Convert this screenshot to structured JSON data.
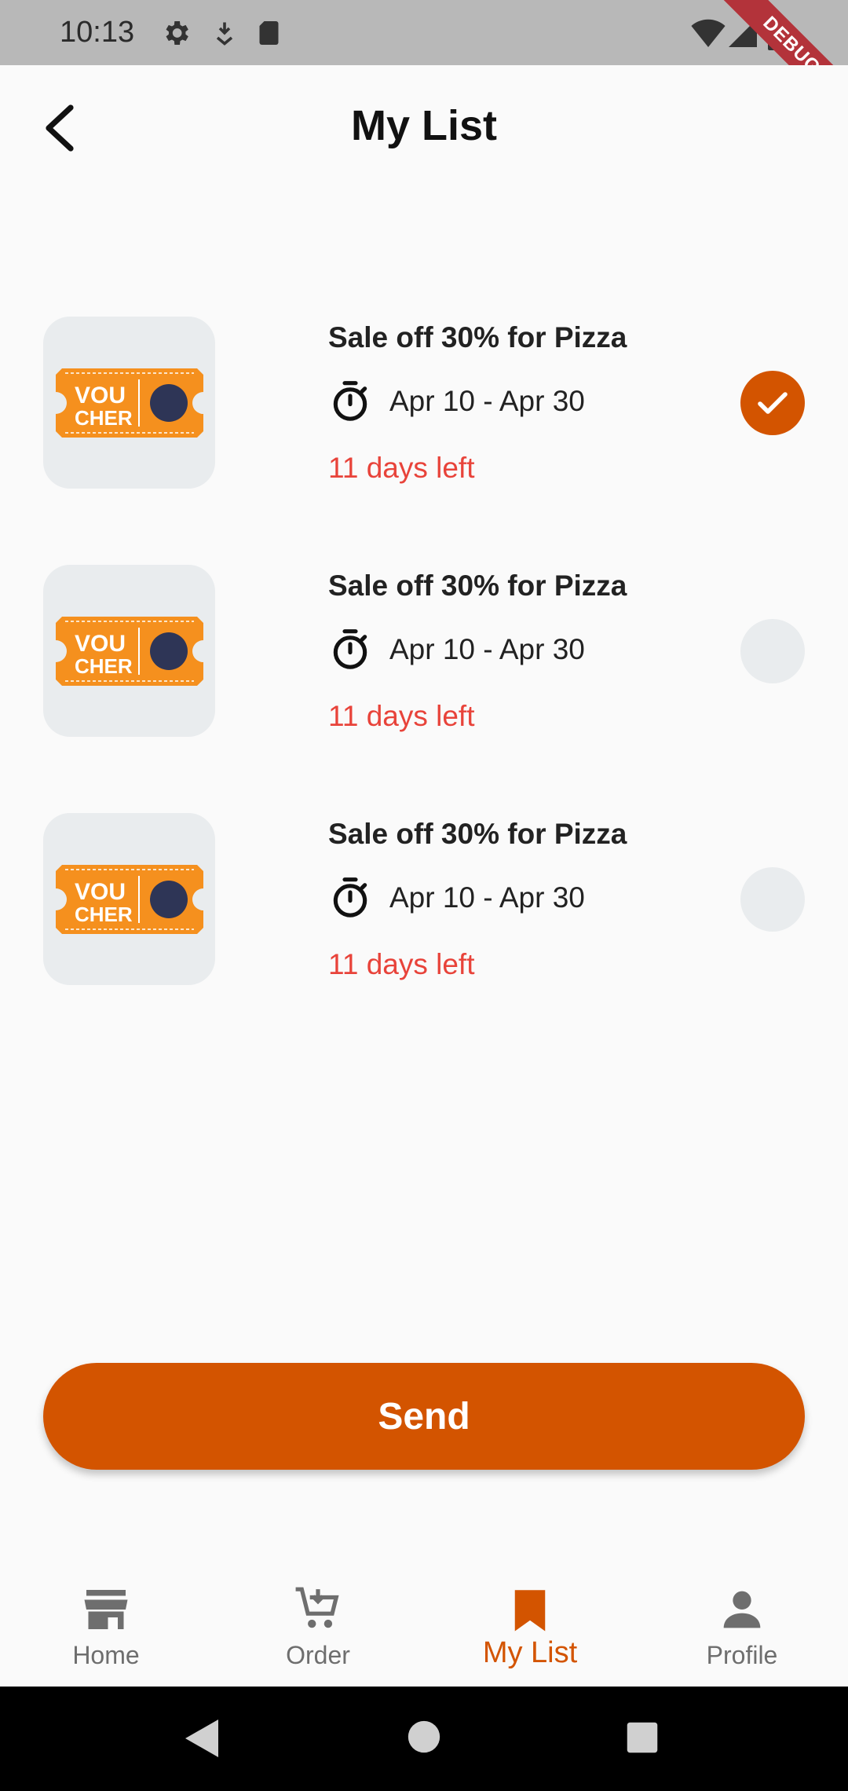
{
  "status_bar": {
    "time": "10:13",
    "debug_label": "DEBUG"
  },
  "app_bar": {
    "title": "My List"
  },
  "vouchers": [
    {
      "title": "Sale off 30% for Pizza",
      "date_range": "Apr 10 - Apr 30",
      "days_left": "11 days left",
      "selected": true
    },
    {
      "title": "Sale off 30% for Pizza",
      "date_range": "Apr 10 - Apr 30",
      "days_left": "11 days left",
      "selected": false
    },
    {
      "title": "Sale off 30% for Pizza",
      "date_range": "Apr 10 - Apr 30",
      "days_left": "11 days left",
      "selected": false
    }
  ],
  "voucher_image": {
    "line1": "VOU",
    "line2": "CHER"
  },
  "send_button": {
    "label": "Send"
  },
  "bottom_nav": {
    "items": [
      {
        "label": "Home",
        "icon": "store-icon"
      },
      {
        "label": "Order",
        "icon": "cart-icon"
      },
      {
        "label": "My List",
        "icon": "bookmark-icon",
        "active": true
      },
      {
        "label": "Profile",
        "icon": "person-icon"
      }
    ]
  },
  "colors": {
    "accent": "#d35400",
    "warning": "#e8433a",
    "thumb_bg": "#e9ecee"
  }
}
